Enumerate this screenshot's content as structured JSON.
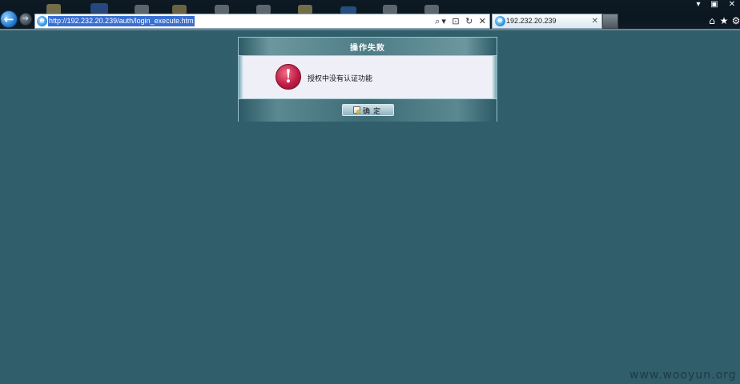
{
  "browser": {
    "address_url": "http://192.232.20.239/auth/login_execute.htm",
    "address_tools": "⌕▾ ⊡ ↻ ✕",
    "tab_title": "192.232.20.239",
    "tab_close": "✕",
    "back_glyph": "←",
    "forward_glyph": "➔",
    "window_buttons": {
      "minimize": "▾",
      "restore": "▣",
      "close": "✕"
    },
    "command_icons": {
      "home": "⌂",
      "favorites": "★",
      "tools": "⚙"
    }
  },
  "dialog": {
    "title": "操作失败",
    "message": "授权中没有认证功能",
    "icon_glyph": "!",
    "ok_label": "确定"
  },
  "watermark": "www.wooyun.org",
  "colors": {
    "page_background": "#305e6b",
    "dialog_body": "#eeeff7",
    "alert_icon": "#c01d45"
  }
}
